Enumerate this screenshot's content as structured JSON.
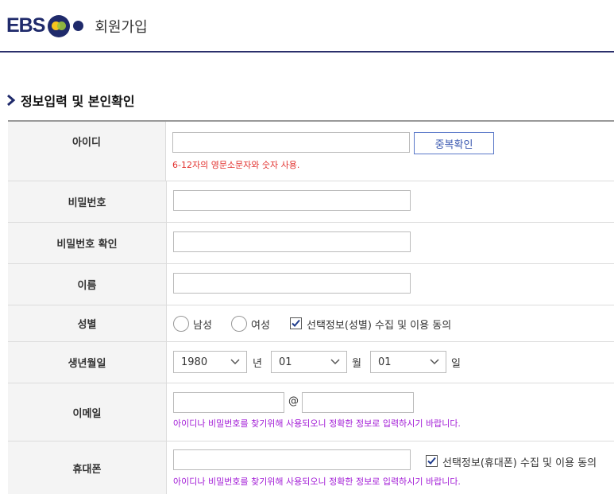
{
  "header": {
    "logo_text": "EBS",
    "title": "회원가입"
  },
  "section": {
    "title": "정보입력 및 본인확인"
  },
  "form": {
    "id": {
      "label": "아이디",
      "check_button": "중복확인",
      "help": "6-12자의 영문소문자와 숫자 사용."
    },
    "password": {
      "label": "비밀번호"
    },
    "password_confirm": {
      "label": "비밀번호 확인"
    },
    "name": {
      "label": "이름"
    },
    "gender": {
      "label": "성별",
      "male": "남성",
      "female": "여성",
      "consent": "선택정보(성별) 수집 및 이용 동의",
      "consent_checked": true
    },
    "birth": {
      "label": "생년월일",
      "year": "1980",
      "year_unit": "년",
      "month": "01",
      "month_unit": "월",
      "day": "01",
      "day_unit": "일"
    },
    "email": {
      "label": "이메일",
      "at": "@",
      "help": "아이디나 비밀번호를 찾기위해 사용되오니 정확한 정보로 입력하시기 바랍니다."
    },
    "phone": {
      "label": "휴대폰",
      "consent": "선택정보(휴대폰) 수집 및 이용 동의",
      "consent_checked": true,
      "help": "아이디나 비밀번호를 찾기위해 사용되오니 정확한 정보로 입력하시기 바랍니다."
    }
  },
  "colors": {
    "brand": "#1f2a6b",
    "link": "#3a58b0",
    "error": "#e2312e",
    "notice": "#a21bd6"
  }
}
